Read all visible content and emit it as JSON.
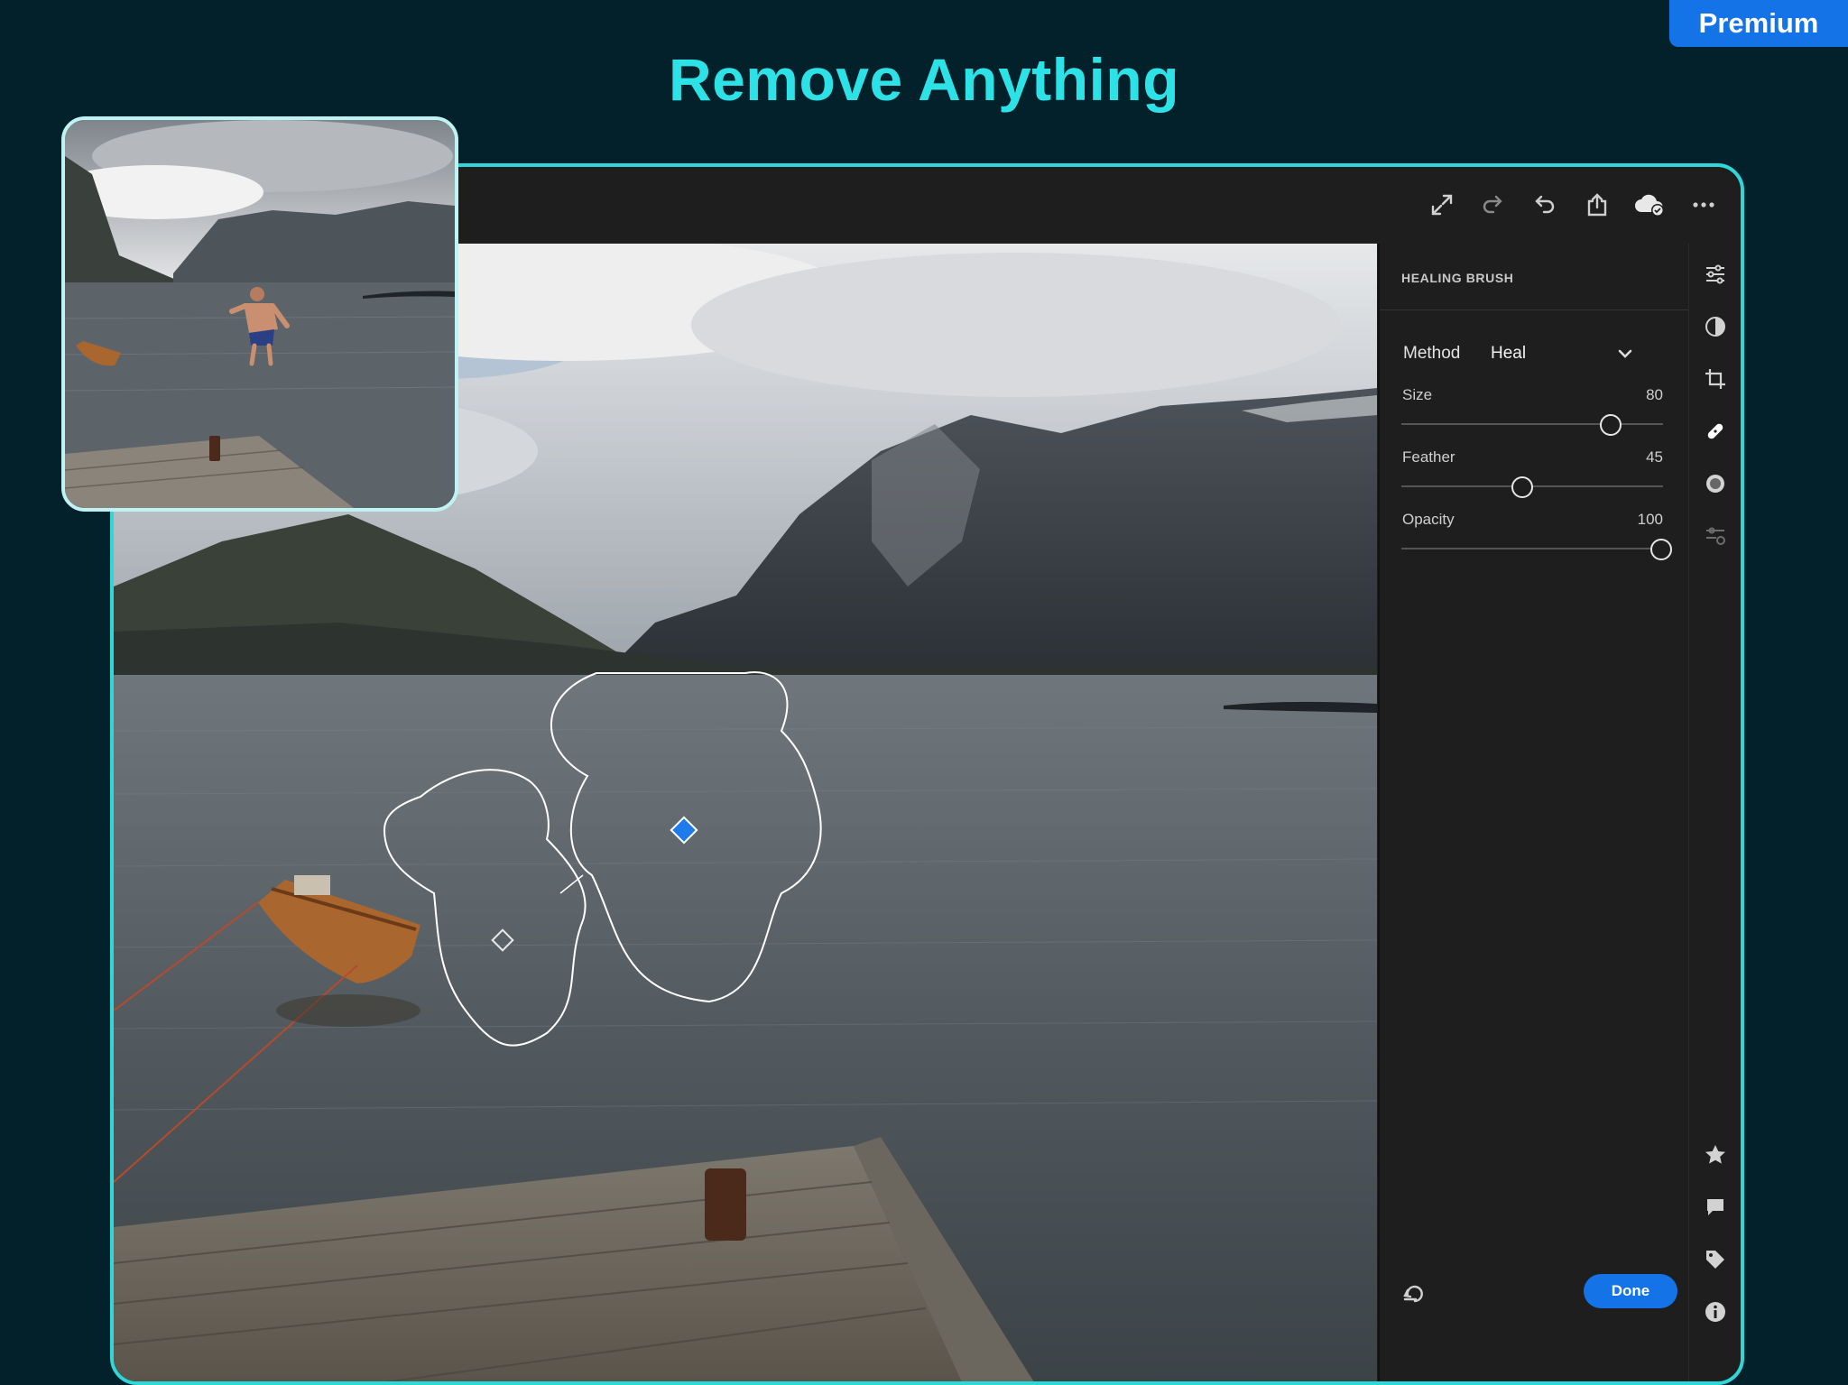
{
  "badge": {
    "premium": "Premium"
  },
  "headline": "Remove Anything",
  "toolbar": {
    "icons": [
      "expand-icon",
      "redo-icon",
      "undo-icon",
      "share-icon",
      "cloud-synced-icon",
      "more-icon"
    ]
  },
  "panel": {
    "title": "HEALING BRUSH",
    "method_label": "Method",
    "method_value": "Heal",
    "sliders": [
      {
        "label": "Size",
        "value": "80",
        "fraction": 0.8
      },
      {
        "label": "Feather",
        "value": "45",
        "fraction": 0.45
      },
      {
        "label": "Opacity",
        "value": "100",
        "fraction": 1.0
      }
    ],
    "done_label": "Done"
  },
  "rail": {
    "top_icons": [
      "edit-sliders-icon",
      "masking-icon",
      "crop-icon",
      "healing-brush-icon",
      "vignette-icon",
      "presets-icon"
    ],
    "bottom_icons": [
      "star-icon",
      "comment-icon",
      "tag-icon",
      "info-icon"
    ]
  },
  "colors": {
    "background": "#03212a",
    "accent_cyan": "#2de2e6",
    "brand_blue": "#1473e6",
    "panel": "#1e1e1e"
  }
}
